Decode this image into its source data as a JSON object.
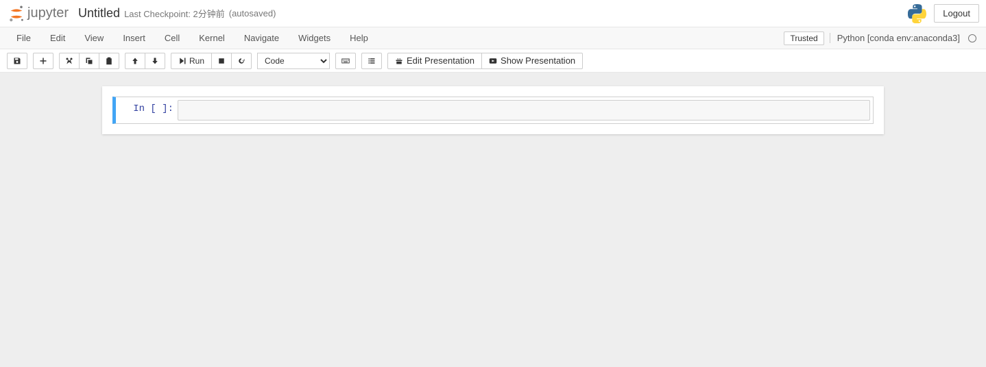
{
  "header": {
    "logo_text": "jupyter",
    "notebook_name": "Untitled",
    "checkpoint": "Last Checkpoint: 2分钟前",
    "autosave": "(autosaved)",
    "logout": "Logout"
  },
  "menubar": {
    "items": [
      "File",
      "Edit",
      "View",
      "Insert",
      "Cell",
      "Kernel",
      "Navigate",
      "Widgets",
      "Help"
    ],
    "trusted": "Trusted",
    "kernel": "Python [conda env:anaconda3]"
  },
  "toolbar": {
    "run": "Run",
    "cell_type": "Code",
    "edit_presentation": "Edit Presentation",
    "show_presentation": "Show Presentation"
  },
  "cell": {
    "prompt": "In [ ]:",
    "content": ""
  }
}
